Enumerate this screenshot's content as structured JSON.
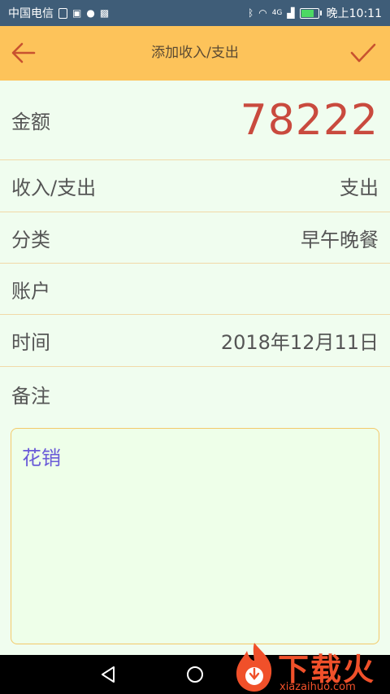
{
  "status_bar": {
    "carrier": "中国电信",
    "time": "晚上10:11",
    "network": "4G",
    "battery_fraction": 0.7
  },
  "app_bar": {
    "title": "添加收入/支出",
    "back_icon": "arrow-left-icon",
    "confirm_icon": "check-icon"
  },
  "form": {
    "amount_label": "金额",
    "amount_value": "78222",
    "type_label": "收入/支出",
    "type_value": "支出",
    "category_label": "分类",
    "category_value": "早午晚餐",
    "account_label": "账户",
    "account_value": "",
    "time_label": "时间",
    "time_value": "2018年12月11日",
    "notes_label": "备注",
    "notes_value": "花销"
  },
  "nav_bar": {
    "back_icon": "triangle-back-icon",
    "home_icon": "circle-home-icon"
  },
  "watermark": {
    "text": "下载火",
    "url": "xiazaihuo.com"
  },
  "colors": {
    "status_bar": "#3f5d78",
    "app_bar": "#fdc35a",
    "background": "#f0fdef",
    "amount": "#c94a3e",
    "notes_text": "#6a5bd8",
    "icon": "#c8522f"
  }
}
